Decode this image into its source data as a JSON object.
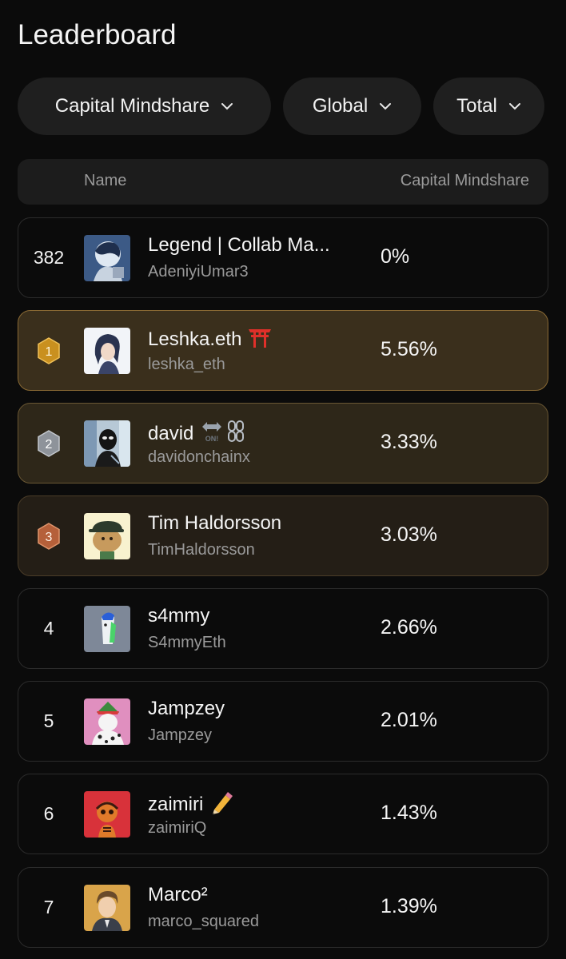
{
  "page": {
    "title": "Leaderboard"
  },
  "filters": [
    {
      "label": "Capital Mindshare"
    },
    {
      "label": "Global"
    },
    {
      "label": "Total"
    }
  ],
  "table": {
    "headers": {
      "name": "Name",
      "value": "Capital Mindshare"
    },
    "self_row": {
      "rank": "382",
      "name": "Legend | Collab Ma...",
      "handle": "AdeniyiUmar3",
      "value": "0%"
    },
    "rows": [
      {
        "rank": "1",
        "name": "Leshka.eth",
        "handle": "leshka_eth",
        "value": "5.56%",
        "badge": "gold",
        "name_icon": "torii-gate-icon"
      },
      {
        "rank": "2",
        "name": "david",
        "handle": "davidonchainx",
        "value": "3.33%",
        "badge": "silver",
        "name_icon": "on-arrow-chain-icon"
      },
      {
        "rank": "3",
        "name": "Tim Haldorsson",
        "handle": "TimHaldorsson",
        "value": "3.03%",
        "badge": "bronze"
      },
      {
        "rank": "4",
        "name": "s4mmy",
        "handle": "S4mmyEth",
        "value": "2.66%"
      },
      {
        "rank": "5",
        "name": "Jampzey",
        "handle": "Jampzey",
        "value": "2.01%"
      },
      {
        "rank": "6",
        "name": "zaimiri",
        "handle": "zaimiriQ",
        "value": "1.43%",
        "name_icon": "pencil-icon"
      },
      {
        "rank": "7",
        "name": "Marco²",
        "handle": "marco_squared",
        "value": "1.39%"
      }
    ]
  },
  "colors": {
    "background": "#0b0b0b",
    "pill": "#1f1f1f",
    "gold_row": "#3a2f1c",
    "silver_row": "#2e2719",
    "bronze_row": "#241e16",
    "gold_badge": "#c9901f",
    "silver_badge": "#8e939a",
    "bronze_badge": "#b5603a"
  }
}
